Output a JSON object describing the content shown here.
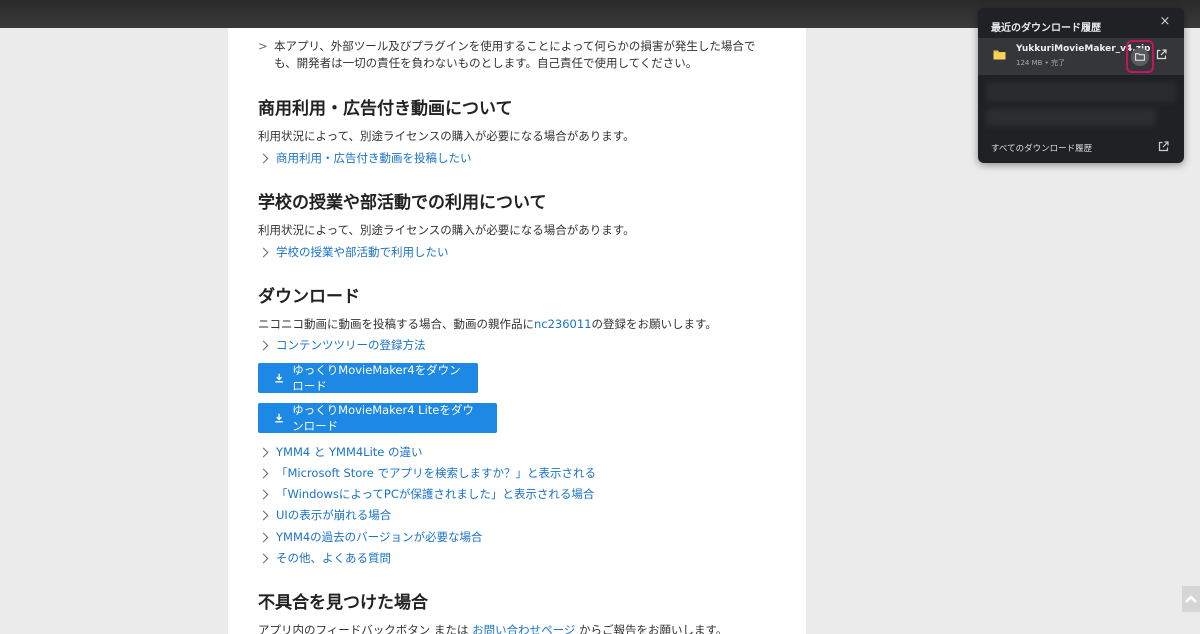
{
  "notice": {
    "bullet": ">",
    "text": "本アプリ、外部ツール及びプラグインを使用することによって何らかの損害が発生した場合でも、開発者は一切の責任を負わないものとします。自己責任で使用してください。"
  },
  "sections": {
    "commercial": {
      "heading": "商用利用・広告付き動画について",
      "text": "利用状況によって、別途ライセンスの購入が必要になる場合があります。",
      "link": "商用利用・広告付き動画を投稿したい"
    },
    "school": {
      "heading": "学校の授業や部活動での利用について",
      "text": "利用状況によって、別途ライセンスの購入が必要になる場合があります。",
      "link": "学校の授業や部活動で利用したい"
    },
    "download": {
      "heading": "ダウンロード",
      "text_before": "ニコニコ動画に動画を投稿する場合、動画の親作品に",
      "text_link": "nc236011",
      "text_after": "の登録をお願いします。",
      "tree_link": "コンテンツツリーの登録方法",
      "button_main": "ゆっくりMovieMaker4をダウンロード",
      "button_lite": "ゆっくりMovieMaker4 Liteをダウンロード",
      "links": [
        "YMM4 と YMM4Lite の違い",
        "「Microsoft Store でアプリを検索しますか？」と表示される",
        "「WindowsによってPCが保護されました」と表示される場合",
        "UIの表示が崩れる場合",
        "YMM4の過去のバージョンが必要な場合",
        "その他、よくある質問"
      ]
    },
    "bugs": {
      "heading": "不具合を見つけた場合",
      "text_before": "アプリ内のフィードバックボタン または ",
      "text_link": "お問い合わせページ",
      "text_after": " からご報告をお願いします。"
    }
  },
  "downloads_panel": {
    "title": "最近のダウンロード履歴",
    "close": "×",
    "item": {
      "file_name": "YukkuriMovieMaker_v4.zip",
      "meta": "124 MB • 完了"
    },
    "footer": "すべてのダウンロード履歴"
  },
  "colors": {
    "link": "#1a73c8",
    "button": "#1e88e5",
    "panel_bg": "#202124",
    "highlight": "#c2185b"
  }
}
